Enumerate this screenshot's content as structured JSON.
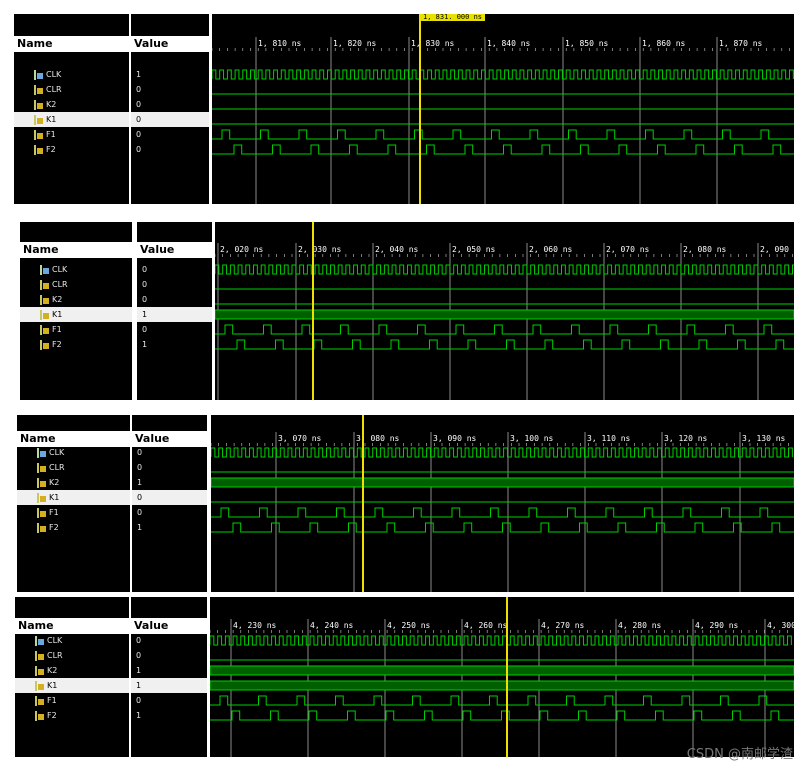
{
  "headers": {
    "name": "Name",
    "value": "Value"
  },
  "colors": {
    "wave": "#00d000",
    "grid": "#8a8a8a",
    "cursor": "#f0e000",
    "background": "#000000"
  },
  "panels": [
    {
      "ticks": [
        "1, 810  ns",
        "1, 820  ns",
        "1, 830  ns",
        "1, 840  ns",
        "1, 850  ns",
        "1, 860  ns",
        "1, 870  ns"
      ],
      "cursor_label": "1, 831. 000  ns",
      "signals": [
        {
          "name": "CLK",
          "value": "1",
          "icon": "clock-signal-icon"
        },
        {
          "name": "CLR",
          "value": "0",
          "icon": "signal-icon"
        },
        {
          "name": "K2",
          "value": "0",
          "icon": "signal-icon"
        },
        {
          "name": "K1",
          "value": "0",
          "icon": "signal-icon",
          "selected": true
        },
        {
          "name": "F1",
          "value": "0",
          "icon": "signal-icon"
        },
        {
          "name": "F2",
          "value": "0",
          "icon": "signal-icon"
        }
      ]
    },
    {
      "ticks": [
        "2, 020  ns",
        "2, 030  ns",
        "2, 040  ns",
        "2, 050  ns",
        "2, 060  ns",
        "2, 070  ns",
        "2, 080  ns",
        "2, 090  n"
      ],
      "cursor_label": "",
      "signals": [
        {
          "name": "CLK",
          "value": "0",
          "icon": "clock-signal-icon"
        },
        {
          "name": "CLR",
          "value": "0",
          "icon": "signal-icon"
        },
        {
          "name": "K2",
          "value": "0",
          "icon": "signal-icon"
        },
        {
          "name": "K1",
          "value": "1",
          "icon": "signal-icon",
          "selected": true
        },
        {
          "name": "F1",
          "value": "0",
          "icon": "signal-icon"
        },
        {
          "name": "F2",
          "value": "1",
          "icon": "signal-icon"
        }
      ]
    },
    {
      "ticks": [
        "3, 070  ns",
        "3, 080  ns",
        "3, 090  ns",
        "3, 100  ns",
        "3, 110  ns",
        "3, 120  ns",
        "3, 130  ns"
      ],
      "cursor_label": "",
      "signals": [
        {
          "name": "CLK",
          "value": "0",
          "icon": "clock-signal-icon"
        },
        {
          "name": "CLR",
          "value": "0",
          "icon": "signal-icon"
        },
        {
          "name": "K2",
          "value": "1",
          "icon": "signal-icon"
        },
        {
          "name": "K1",
          "value": "0",
          "icon": "signal-icon",
          "selected": true
        },
        {
          "name": "F1",
          "value": "0",
          "icon": "signal-icon"
        },
        {
          "name": "F2",
          "value": "1",
          "icon": "signal-icon"
        }
      ]
    },
    {
      "ticks": [
        "4, 230  ns",
        "4, 240  ns",
        "4, 250  ns",
        "4, 260  ns",
        "4, 270  ns",
        "4, 280  ns",
        "4, 290  ns",
        "4, 300"
      ],
      "cursor_label": "",
      "signals": [
        {
          "name": "CLK",
          "value": "0",
          "icon": "clock-signal-icon"
        },
        {
          "name": "CLR",
          "value": "0",
          "icon": "signal-icon"
        },
        {
          "name": "K2",
          "value": "1",
          "icon": "signal-icon"
        },
        {
          "name": "K1",
          "value": "1",
          "icon": "signal-icon",
          "selected": true
        },
        {
          "name": "F1",
          "value": "0",
          "icon": "signal-icon"
        },
        {
          "name": "F2",
          "value": "1",
          "icon": "signal-icon"
        }
      ]
    }
  ],
  "watermark": "CSDN @南邮学渣"
}
